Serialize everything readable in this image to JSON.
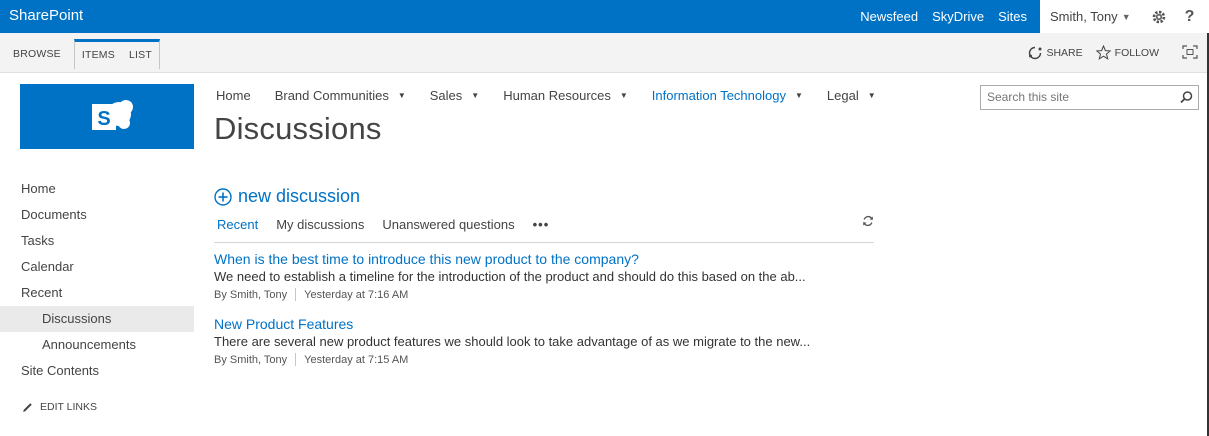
{
  "suite": {
    "brand": "SharePoint",
    "links": [
      "Newsfeed",
      "SkyDrive",
      "Sites"
    ],
    "user": "Smith, Tony",
    "help": "?",
    "colors": {
      "suite_blue": "#0072c6",
      "link_blue": "#0072c6"
    }
  },
  "ribbon": {
    "tabs": [
      "BROWSE",
      "ITEMS",
      "LIST"
    ],
    "share": "SHARE",
    "follow": "FOLLOW"
  },
  "topnav": {
    "items": [
      "Home",
      "Brand Communities",
      "Sales",
      "Human Resources",
      "Information Technology",
      "Legal"
    ],
    "current": "Information Technology"
  },
  "page": {
    "title": "Discussions"
  },
  "search": {
    "placeholder": "Search this site"
  },
  "leftnav": {
    "items": [
      "Home",
      "Documents",
      "Tasks",
      "Calendar",
      "Recent"
    ],
    "sub_items": [
      "Discussions",
      "Announcements"
    ],
    "site_contents": "Site Contents",
    "edit_links": "EDIT LINKS"
  },
  "main": {
    "new_discussion": "new discussion",
    "views": [
      "Recent",
      "My discussions",
      "Unanswered questions"
    ],
    "more": "•••",
    "posts": [
      {
        "title": "When is the best time to introduce this new product to the company?",
        "body": "We need to establish a timeline for the introduction of the product and should do this based on the ab...",
        "author": "By Smith, Tony",
        "time": "Yesterday at 7:16 AM"
      },
      {
        "title": "New Product Features",
        "body": "There are several new product features we should look to take advantage of as we migrate to the new...",
        "author": "By Smith, Tony",
        "time": "Yesterday at 7:15 AM"
      }
    ]
  }
}
